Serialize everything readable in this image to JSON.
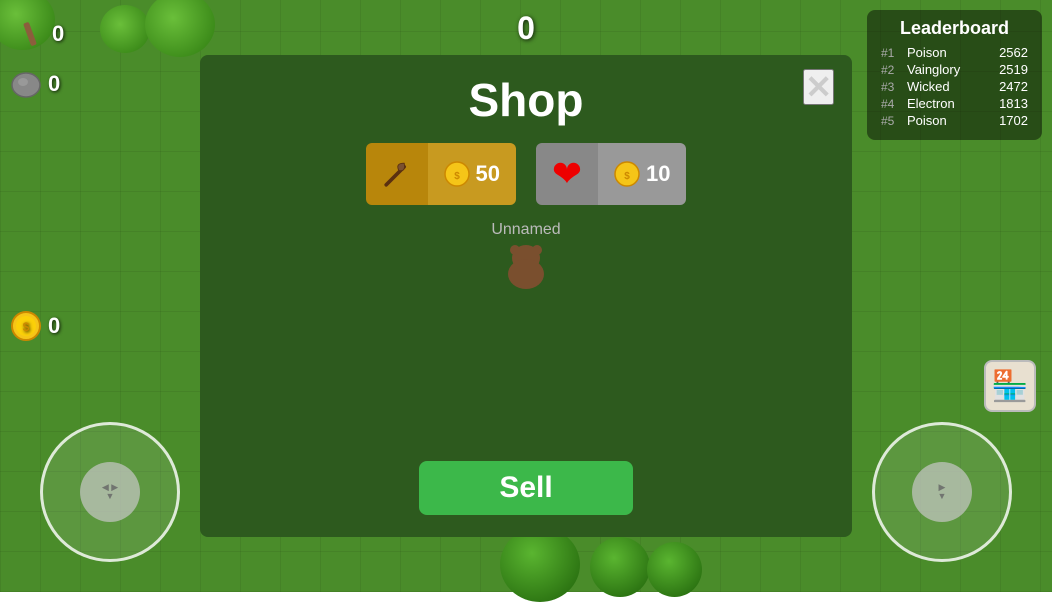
{
  "game": {
    "score": "0",
    "bg_color": "#4a8c2a"
  },
  "resources": {
    "wood_count": "0",
    "stone_count": "0",
    "coin_count": "0"
  },
  "leaderboard": {
    "title": "Leaderboard",
    "entries": [
      {
        "rank": "#1",
        "name": "Poison",
        "score": "2562"
      },
      {
        "rank": "#2",
        "name": "Vainglory",
        "score": "2519"
      },
      {
        "rank": "#3",
        "name": "Wicked",
        "score": "2472"
      },
      {
        "rank": "#4",
        "name": "Electron",
        "score": "1813"
      },
      {
        "rank": "#5",
        "name": "Poison",
        "score": "1702"
      }
    ]
  },
  "shop": {
    "title": "Shop",
    "close_label": "✕",
    "player_name": "Unnamed",
    "items": [
      {
        "id": "axe",
        "price": "50"
      },
      {
        "id": "heart",
        "price": "10"
      }
    ],
    "sell_label": "Sell"
  }
}
